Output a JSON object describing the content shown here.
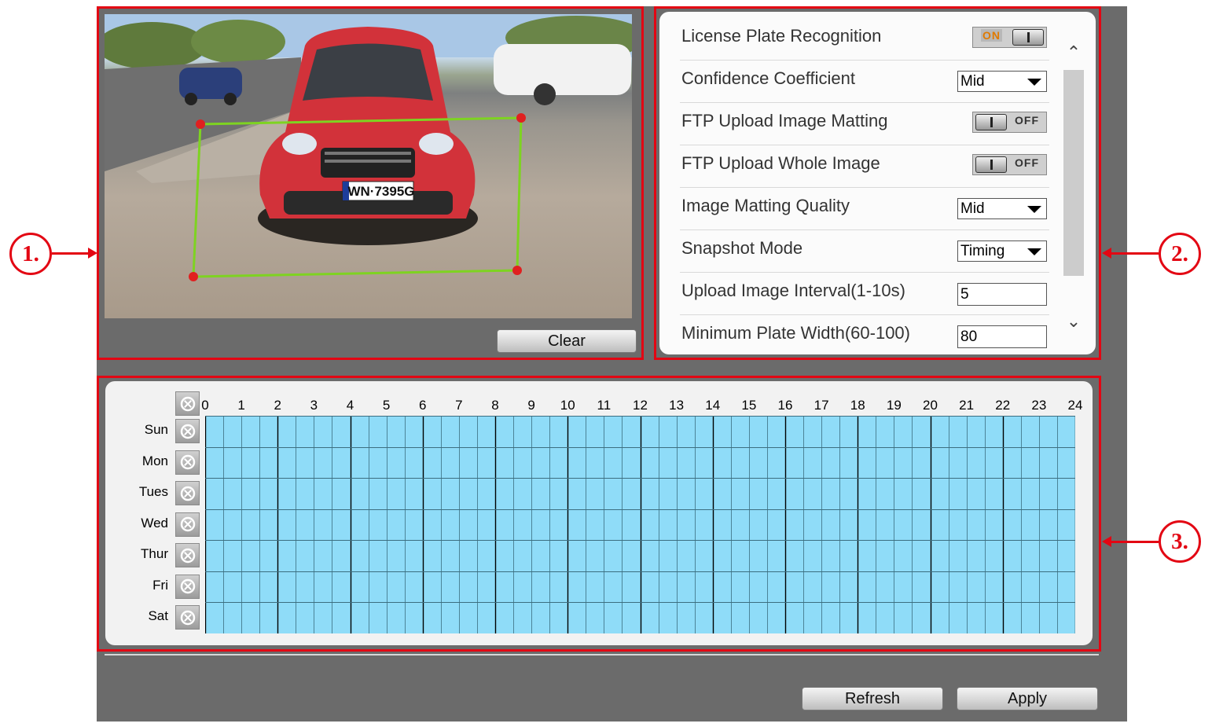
{
  "video": {
    "plate_text": "WN·7395G",
    "clear_label": "Clear"
  },
  "settings": {
    "rows": [
      {
        "label": "License Plate Recognition",
        "control": "toggle",
        "value": "ON"
      },
      {
        "label": "Confidence Coefficient",
        "control": "select",
        "value": "Mid"
      },
      {
        "label": "FTP Upload Image Matting",
        "control": "toggle",
        "value": "OFF"
      },
      {
        "label": "FTP Upload Whole Image",
        "control": "toggle",
        "value": "OFF"
      },
      {
        "label": "Image Matting Quality",
        "control": "select",
        "value": "Mid"
      },
      {
        "label": "Snapshot Mode",
        "control": "select",
        "value": "Timing"
      },
      {
        "label": "Upload Image Interval(1-10s)",
        "control": "input",
        "value": "5"
      },
      {
        "label": "Minimum Plate Width(60-100)",
        "control": "input",
        "value": "80"
      }
    ]
  },
  "schedule": {
    "hours": [
      "0",
      "1",
      "2",
      "3",
      "4",
      "5",
      "6",
      "7",
      "8",
      "9",
      "10",
      "11",
      "12",
      "13",
      "14",
      "15",
      "16",
      "17",
      "18",
      "19",
      "20",
      "21",
      "22",
      "23",
      "24"
    ],
    "days": [
      "Sun",
      "Mon",
      "Tues",
      "Wed",
      "Thur",
      "Fri",
      "Sat"
    ],
    "cell_color": "#8fdcf8",
    "all_selected": true
  },
  "footer": {
    "refresh_label": "Refresh",
    "apply_label": "Apply"
  },
  "annotations": [
    "1.",
    "2.",
    "3."
  ],
  "colors": {
    "annotation_red": "#e30613",
    "panel_bg": "#6b6b6b",
    "toggle_on": "#e07a00",
    "roi_line": "#7ed321"
  }
}
